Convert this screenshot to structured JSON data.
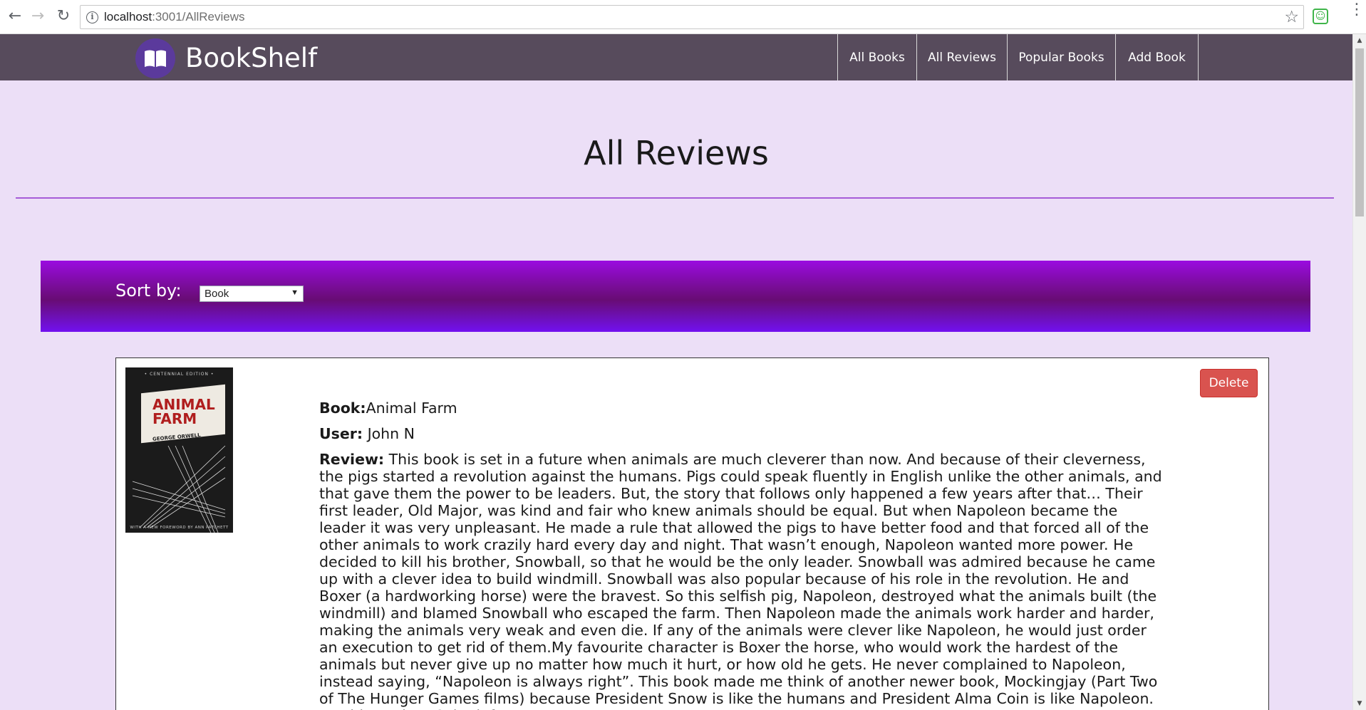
{
  "browser": {
    "url_host": "localhost",
    "url_path": ":3001/AllReviews"
  },
  "navbar": {
    "brand": "BookShelf",
    "links": [
      "All Books",
      "All Reviews",
      "Popular Books",
      "Add Book"
    ]
  },
  "main": {
    "title": "All Reviews",
    "sort_label": "Sort by:",
    "sort_selected": "Book"
  },
  "review": {
    "delete_label": "Delete",
    "cover": {
      "edition": "• CENTENNIAL EDITION •",
      "title": "ANIMAL FARM",
      "author": "GEORGE ORWELL",
      "foot": "WITH A NEW FOREWORD BY ANN PATCHETT"
    },
    "book_label": "Book:",
    "book": "Animal Farm",
    "user_label": "User:",
    "user": "John N",
    "review_label": "Review:",
    "text": "This book is set in a future when animals are much cleverer than now. And because of their cleverness, the pigs started a revolution against the humans. Pigs could speak fluently in English unlike the other animals, and that gave them the power to be leaders. But, the story that follows only happened a few years after that… Their first leader, Old Major, was kind and fair who knew animals should be equal. But when Napoleon became the leader it was very unpleasant. He made a rule that allowed the pigs to have better food and that forced all of the other animals to work crazily hard every day and night. That wasn’t enough, Napoleon wanted more power. He decided to kill his brother, Snowball, so that he would be the only leader. Snowball was admired because he came up with a clever idea to build windmill. Snowball was also popular because of his role in the revolution. He and Boxer (a hardworking horse) were the bravest. So this selfish pig, Napoleon, destroyed what the animals built (the windmill) and blamed Snowball who escaped the farm. Then Napoleon made the animals work harder and harder, making the animals very weak and even die. If any of the animals were clever like Napoleon, he would just order an execution to get rid of them.My favourite character is Boxer the horse, who would work the hardest of the animals but never give up no matter how much it hurt, or how old he gets. He never complained to Napoleon, instead saying, “Napoleon is always right”. This book made me think of another newer book, Mockingjay (Part Two of The Hunger Games films) because President Snow is like the humans and President Alma Coin is like Napoleon. President Alma Coin defeats"
  }
}
